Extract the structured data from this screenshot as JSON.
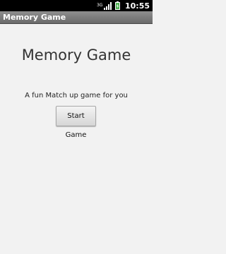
{
  "status_bar": {
    "network_label": "3G",
    "time": "10:55",
    "icons": [
      "network-3g-icon",
      "signal-strength-icon",
      "battery-charging-icon"
    ],
    "battery_color": "#4caf50"
  },
  "title_bar": {
    "title": "Memory Game"
  },
  "main": {
    "heading": "Memory Game",
    "tagline": "A fun Match up game for you",
    "start_button_label": "Start Game"
  }
}
